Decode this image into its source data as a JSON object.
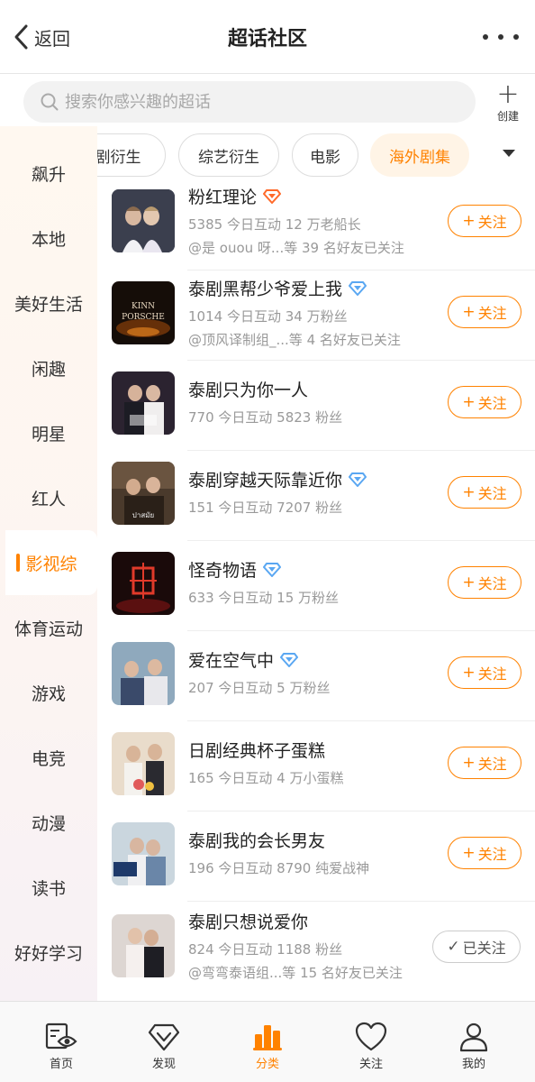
{
  "nav": {
    "back_label": "返回",
    "title": "超话社区"
  },
  "search": {
    "placeholder": "搜索你感兴趣的超话",
    "create_label": "创建"
  },
  "sidebar": {
    "items": [
      {
        "label": "飙升"
      },
      {
        "label": "本地"
      },
      {
        "label": "美好生活"
      },
      {
        "label": "闲趣"
      },
      {
        "label": "明星"
      },
      {
        "label": "红人"
      },
      {
        "label": "影视综"
      },
      {
        "label": "体育运动"
      },
      {
        "label": "游戏"
      },
      {
        "label": "电竞"
      },
      {
        "label": "动漫"
      },
      {
        "label": "读书"
      },
      {
        "label": "好好学习"
      }
    ],
    "active": "影视综"
  },
  "chips": [
    {
      "label": "剧衍生"
    },
    {
      "label": "综艺衍生"
    },
    {
      "label": "电影"
    },
    {
      "label": "海外剧集",
      "active": true
    }
  ],
  "list": [
    {
      "title": "粉红理论",
      "badge": "orange",
      "meta": "5385 今日互动 12 万老船长",
      "friends": "@是 ouou 呀...等 39 名好友已关注",
      "follow": "关注",
      "thumb_bg": "#3a3d4a"
    },
    {
      "title": "泰剧黑帮少爷爱上我",
      "badge": "blue",
      "meta": "1014 今日互动 34 万粉丝",
      "friends": "@顶风译制组_...等 4 名好友已关注",
      "follow": "关注",
      "thumb_text": "KINN PORSCHE",
      "thumb_bg": "#1a0f0a"
    },
    {
      "title": "泰剧只为你一人",
      "badge": "",
      "meta": "770 今日互动 5823 粉丝",
      "friends": "",
      "follow": "关注",
      "thumb_bg": "#2a2230"
    },
    {
      "title": "泰剧穿越天际靠近你",
      "badge": "blue",
      "meta": "151 今日互动 7207 粉丝",
      "friends": "",
      "follow": "关注",
      "thumb_bg": "#4a3a2c"
    },
    {
      "title": "怪奇物语",
      "badge": "blue",
      "meta": "633 今日互动 15 万粉丝",
      "friends": "",
      "follow": "关注",
      "thumb_bg": "#3a0c0c"
    },
    {
      "title": "爱在空气中",
      "badge": "blue",
      "meta": "207 今日互动 5 万粉丝",
      "friends": "",
      "follow": "关注",
      "thumb_bg": "#7a93a8"
    },
    {
      "title": "日剧经典杯子蛋糕",
      "badge": "",
      "meta": "165 今日互动 4 万小蛋糕",
      "friends": "",
      "follow": "关注",
      "thumb_bg": "#e8d9c8"
    },
    {
      "title": "泰剧我的会长男友",
      "badge": "",
      "meta": "196 今日互动 8790 纯爱战神",
      "friends": "",
      "follow": "关注",
      "thumb_bg": "#c9d6de"
    },
    {
      "title": "泰剧只想说爱你",
      "badge": "",
      "meta": "824 今日互动 1188 粉丝",
      "friends": "@弯弯泰语组...等 15 名好友已关注",
      "follow": "已关注",
      "followed": true,
      "thumb_bg": "#d8d0cc"
    }
  ],
  "tabbar": {
    "items": [
      {
        "label": "首页"
      },
      {
        "label": "发现"
      },
      {
        "label": "分类",
        "active": true
      },
      {
        "label": "关注"
      },
      {
        "label": "我的"
      }
    ]
  },
  "colors": {
    "accent": "#ff8200",
    "badge_blue": "#5aa7f2",
    "badge_orange": "#ff6a2a"
  }
}
